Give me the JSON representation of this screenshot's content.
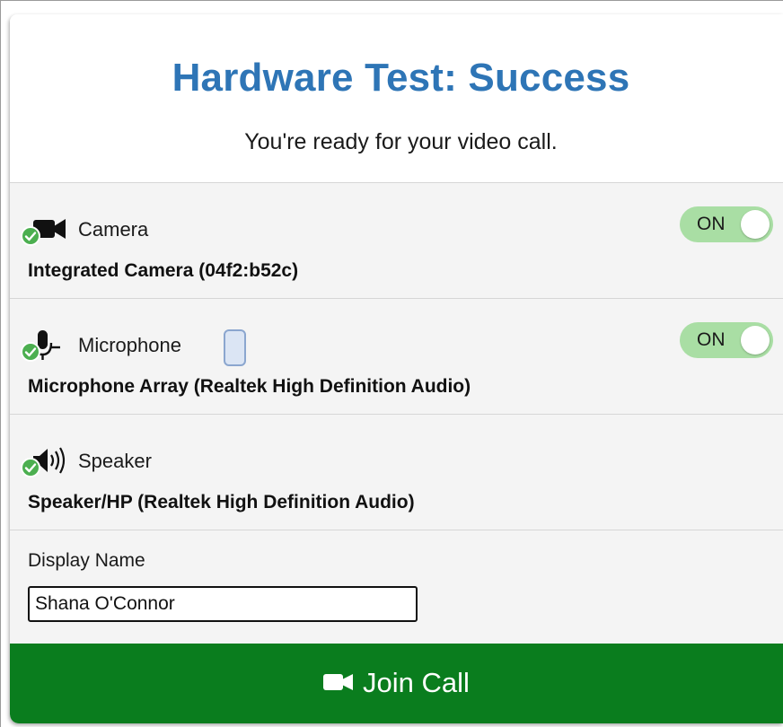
{
  "header": {
    "title": "Hardware Test: Success",
    "subtitle": "You're ready for your video call."
  },
  "devices": {
    "camera": {
      "label": "Camera",
      "device_name": "Integrated Camera (04f2:b52c)",
      "status_icon": "check-circle-icon",
      "icon": "video-camera-icon",
      "toggle_label": "ON",
      "enabled": true
    },
    "microphone": {
      "label": "Microphone",
      "device_name": "Microphone Array (Realtek High Definition Audio)",
      "status_icon": "check-circle-icon",
      "icon": "microphone-icon",
      "toggle_label": "ON",
      "enabled": true,
      "input_level": 0
    },
    "speaker": {
      "label": "Speaker",
      "device_name": "Speaker/HP (Realtek High Definition Audio)",
      "status_icon": "check-circle-icon",
      "icon": "speaker-icon"
    }
  },
  "display_name": {
    "label": "Display Name",
    "value": "Shana O'Connor"
  },
  "join": {
    "label": "Join Call",
    "icon": "video-camera-icon"
  },
  "colors": {
    "title": "#2e75b6",
    "success": "#4caf50",
    "toggle_on": "#a9dea4",
    "join_button": "#0a7d1e"
  }
}
